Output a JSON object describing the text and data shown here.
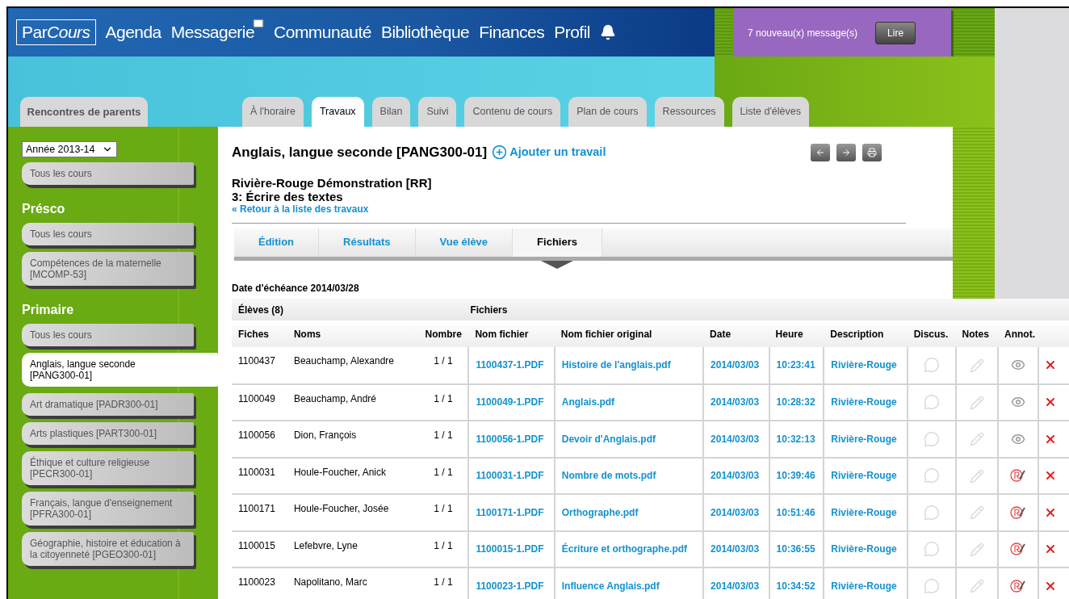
{
  "nav": {
    "logo": [
      {
        "text": "Par",
        "italic": false
      },
      {
        "text": "Cours",
        "italic": true
      }
    ],
    "items": [
      {
        "label": "Agenda",
        "kind": "plain"
      },
      {
        "label": "Messagerie",
        "kind": "mail"
      },
      {
        "label": "Communauté",
        "kind": "plain"
      },
      {
        "label": "Bibliothèque",
        "kind": "plain"
      },
      {
        "label": "Finances",
        "kind": "plain"
      },
      {
        "label": "Profil",
        "kind": "plain"
      }
    ]
  },
  "message_banner": {
    "text": "7 nouveau(x) message(s)",
    "button": "Lire"
  },
  "side_tab": "Rencontres de parents",
  "tabs": [
    {
      "label": "À l'horaire",
      "selected": false
    },
    {
      "label": "Travaux",
      "selected": true
    },
    {
      "label": "Bilan",
      "selected": false
    },
    {
      "label": "Suivi",
      "selected": false
    },
    {
      "label": "Contenu de cours",
      "selected": false
    },
    {
      "label": "Plan de cours",
      "selected": false
    },
    {
      "label": "Ressources",
      "selected": false
    },
    {
      "label": "Liste d'élèves",
      "selected": false
    }
  ],
  "sidebar": {
    "year": "Année 2013-14",
    "sections": [
      {
        "items": [
          {
            "label": "Tous les cours",
            "selected": false
          }
        ]
      },
      {
        "heading": "Présco",
        "items": [
          {
            "label": "Tous les cours",
            "selected": false
          },
          {
            "label": "Compétences de la maternelle [MCOMP-53]",
            "selected": false
          }
        ]
      },
      {
        "heading": "Primaire",
        "items": [
          {
            "label": "Tous les cours",
            "selected": false
          },
          {
            "label": "Anglais, langue seconde [PANG300-01]",
            "selected": true
          },
          {
            "label": "Art dramatique [PADR300-01]",
            "selected": false
          },
          {
            "label": "Arts plastiques [PART300-01]",
            "selected": false
          },
          {
            "label": "Éthique et culture religieuse [PECR300-01]",
            "selected": false
          },
          {
            "label": "Français, langue d'enseignement [PFRA300-01]",
            "selected": false
          },
          {
            "label": "Géographie, histoire et éducation à la citoyenneté [PGEO300-01]",
            "selected": false
          }
        ]
      }
    ]
  },
  "content": {
    "title": "Anglais, langue seconde [PANG300-01]",
    "add_link": "Ajouter un travail",
    "school": "Rivière-Rouge Démonstration [RR]",
    "assignment": "3: Écrire des textes",
    "back_link": "« Retour à la liste des travaux",
    "subtabs": [
      {
        "label": "Édition",
        "selected": false
      },
      {
        "label": "Résultats",
        "selected": false
      },
      {
        "label": "Vue élève",
        "selected": false
      },
      {
        "label": "Fichiers",
        "selected": true
      }
    ],
    "due_date": "Date d'échéance 2014/03/28"
  },
  "table": {
    "groups": [
      "Élèves (8)",
      "Fichiers"
    ],
    "columns": [
      "Fiches",
      "Noms",
      "Nombre",
      "Nom fichier",
      "Nom fichier original",
      "Date",
      "Heure",
      "Description",
      "Discus.",
      "Notes",
      "Annot."
    ],
    "rows": [
      {
        "id": "1100437",
        "name": "Beauchamp, Alexandre",
        "count": "1 / 1",
        "file": "1100437-1.PDF",
        "original": "Histoire de l'anglais.pdf",
        "date": "2014/03/03",
        "time": "10:23:41",
        "description": "Rivière-Rouge",
        "annot": {
          "kind": "view"
        }
      },
      {
        "id": "1100049",
        "name": "Beauchamp, André",
        "count": "1 / 1",
        "file": "1100049-1.PDF",
        "original": "Anglais.pdf",
        "date": "2014/03/03",
        "time": "10:28:32",
        "description": "Rivière-Rouge",
        "annot": {
          "kind": "view"
        }
      },
      {
        "id": "1100056",
        "name": "Dion, François",
        "count": "1 / 1",
        "file": "1100056-1.PDF",
        "original": "Devoir d'Anglais.pdf",
        "date": "2014/03/03",
        "time": "10:32:13",
        "description": "Rivière-Rouge",
        "annot": {
          "kind": "view"
        }
      },
      {
        "id": "1100031",
        "name": "Houle-Foucher, Anick",
        "count": "1 / 1",
        "file": "1100031-1.PDF",
        "original": "Nombre de mots.pdf",
        "date": "2014/03/03",
        "time": "10:39:46",
        "description": "Rivière-Rouge",
        "annot": {
          "kind": "corrected"
        }
      },
      {
        "id": "1100171",
        "name": "Houle-Foucher, Josée",
        "count": "1 / 1",
        "file": "1100171-1.PDF",
        "original": "Orthographe.pdf",
        "date": "2014/03/03",
        "time": "10:51:46",
        "description": "Rivière-Rouge",
        "annot": {
          "kind": "corrected"
        }
      },
      {
        "id": "1100015",
        "name": "Lefebvre, Lyne",
        "count": "1 / 1",
        "file": "1100015-1.PDF",
        "original": "Écriture et orthographe.pdf",
        "date": "2014/03/03",
        "time": "10:36:55",
        "description": "Rivière-Rouge",
        "annot": {
          "kind": "corrected"
        }
      },
      {
        "id": "1100023",
        "name": "Napolitano, Marc",
        "count": "1 / 1",
        "file": "1100023-1.PDF",
        "original": "Influence Anglais.pdf",
        "date": "2014/03/03",
        "time": "10:34:52",
        "description": "Rivière-Rouge",
        "annot": {
          "kind": "corrected"
        }
      }
    ]
  }
}
